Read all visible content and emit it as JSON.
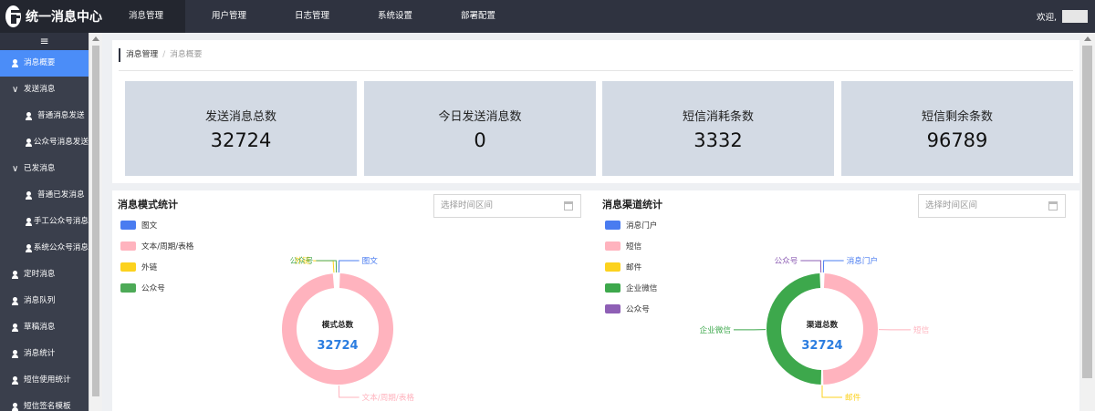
{
  "app": {
    "title": "统一消息中心"
  },
  "topnav": [
    {
      "label": "消息管理",
      "active": true
    },
    {
      "label": "用户管理",
      "active": false
    },
    {
      "label": "日志管理",
      "active": false
    },
    {
      "label": "系统设置",
      "active": false
    },
    {
      "label": "部署配置",
      "active": false
    }
  ],
  "header": {
    "welcome": "欢迎,"
  },
  "sidebar": {
    "toggle": "≡",
    "items": [
      {
        "label": "消息概要",
        "level": 1,
        "icon": "user-icon",
        "active": true
      },
      {
        "label": "发送消息",
        "level": 1,
        "icon": "chevron-down-icon",
        "active": false
      },
      {
        "label": "普通消息发送",
        "level": 2,
        "icon": "user-icon",
        "active": false
      },
      {
        "label": "公众号消息发送",
        "level": 2,
        "icon": "user-icon",
        "active": false
      },
      {
        "label": "已发消息",
        "level": 1,
        "icon": "chevron-down-icon",
        "active": false
      },
      {
        "label": "普通已发消息",
        "level": 2,
        "icon": "user-icon",
        "active": false
      },
      {
        "label": "手工公众号消息",
        "level": 2,
        "icon": "user-icon",
        "active": false
      },
      {
        "label": "系统公众号消息",
        "level": 2,
        "icon": "user-icon",
        "active": false
      },
      {
        "label": "定时消息",
        "level": 1,
        "icon": "user-icon",
        "active": false
      },
      {
        "label": "消息队列",
        "level": 1,
        "icon": "user-icon",
        "active": false
      },
      {
        "label": "草稿消息",
        "level": 1,
        "icon": "user-icon",
        "active": false
      },
      {
        "label": "消息统计",
        "level": 1,
        "icon": "user-icon",
        "active": false
      },
      {
        "label": "短信使用统计",
        "level": 1,
        "icon": "user-icon",
        "active": false
      },
      {
        "label": "短信签名模板",
        "level": 1,
        "icon": "user-icon",
        "active": false
      }
    ]
  },
  "breadcrumb": {
    "root": "消息管理",
    "separator": "/",
    "current": "消息概要"
  },
  "stats": [
    {
      "label": "发送消息总数",
      "value": "32724"
    },
    {
      "label": "今日发送消息数",
      "value": "0"
    },
    {
      "label": "短信消耗条数",
      "value": "3332"
    },
    {
      "label": "短信剩余条数",
      "value": "96789"
    }
  ],
  "charts": {
    "mode": {
      "title": "消息模式统计",
      "date_placeholder": "选择时间区间"
    },
    "channel": {
      "title": "消息渠道统计",
      "date_placeholder": "选择时间区间"
    }
  },
  "chart_data": [
    {
      "type": "pie",
      "title": "消息模式统计",
      "center_label": "模式总数",
      "center_value": "32724",
      "categories": [
        "图文",
        "文本/周期/表格",
        "外链",
        "公众号"
      ],
      "values": [
        0,
        32724,
        0,
        0
      ],
      "colors": [
        "#4a7cf0",
        "#ffb3be",
        "#fcd21e",
        "#4daa57"
      ],
      "legend": "left"
    },
    {
      "type": "pie",
      "title": "消息渠道统计",
      "center_label": "渠道总数",
      "center_value": "32724",
      "categories": [
        "消息门户",
        "短信",
        "邮件",
        "企业微信",
        "公众号"
      ],
      "values": [
        0,
        16362,
        0,
        16362,
        0
      ],
      "colors": [
        "#4a7cf0",
        "#ffb3be",
        "#fcd21e",
        "#3da84c",
        "#8e5fb5"
      ],
      "legend": "left"
    }
  ]
}
